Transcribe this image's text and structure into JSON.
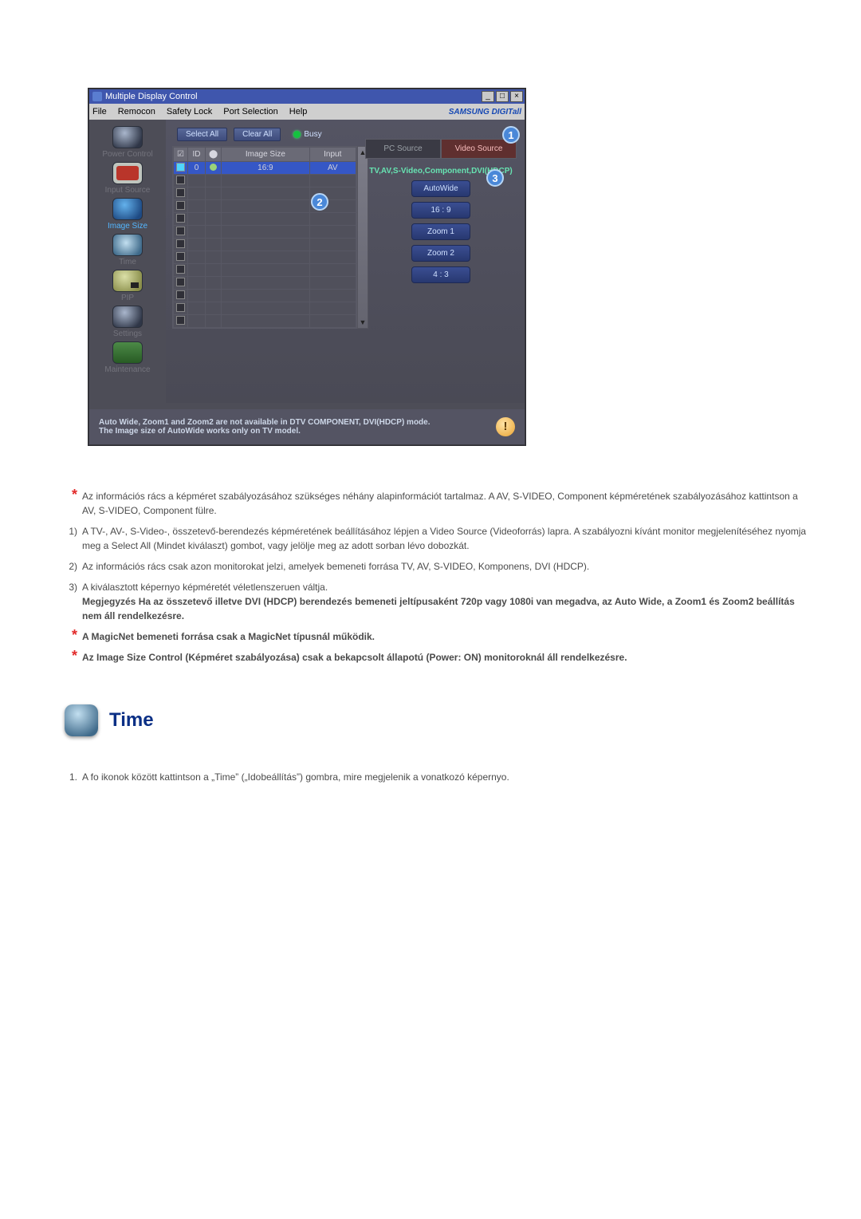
{
  "app": {
    "title": "Multiple Display Control",
    "menus": [
      "File",
      "Remocon",
      "Safety Lock",
      "Port Selection",
      "Help"
    ],
    "brand": "SAMSUNG DIGITall",
    "winbtns": {
      "min": "_",
      "max": "□",
      "close": "×"
    }
  },
  "sidebar": {
    "items": [
      {
        "label": "Power Control"
      },
      {
        "label": "Input Source"
      },
      {
        "label": "Image Size",
        "active": true
      },
      {
        "label": "Time"
      },
      {
        "label": "PIP"
      },
      {
        "label": "Settings"
      },
      {
        "label": "Maintenance"
      }
    ]
  },
  "toolbar": {
    "select_all": "Select All",
    "clear_all": "Clear All",
    "busy": "Busy"
  },
  "grid": {
    "headers": {
      "cb": "☑",
      "id": "ID",
      "lamp": "⬤",
      "size": "Image Size",
      "input": "Input"
    },
    "row0": {
      "id": "0",
      "size": "16:9",
      "input": "AV"
    }
  },
  "right": {
    "tab_pc": "PC Source",
    "tab_video": "Video Source",
    "subhead": "TV,AV,S-Video,Component,DVI(HDCP)",
    "opts": [
      "AutoWide",
      "16 : 9",
      "Zoom 1",
      "Zoom 2",
      "4 : 3"
    ]
  },
  "badges": {
    "b1": "1",
    "b2": "2",
    "b3": "3"
  },
  "footer": {
    "line1": "Auto Wide, Zoom1 and Zoom2 are not available in DTV COMPONENT, DVI(HDCP) mode.",
    "line2": "The Image size of AutoWide works only on TV model.",
    "warn": "!"
  },
  "paragraphs": {
    "p_star1": "Az információs rács a képméret szabályozásához szükséges néhány alapinformációt tartalmaz. A AV, S-VIDEO, Component képméretének szabályozásához kattintson a AV, S-VIDEO, Component fülre.",
    "p1": "A TV-, AV-, S-Video-, összetevő-berendezés képméretének beállításához lépjen a Video Source (Videoforrás) lapra. A szabályozni kívánt monitor megjelenítéséhez nyomja meg a Select All (Mindet kiválaszt) gombot, vagy jelölje meg az adott sorban lévo dobozkát.",
    "p2": "Az információs rács csak azon monitorokat jelzi, amelyek bemeneti forrása TV, AV, S-VIDEO, Komponens, DVI (HDCP).",
    "p3a": "A kiválasztott képernyo képméretét véletlenszeruen váltja.",
    "p3b": "Megjegyzés Ha az összetevő illetve DVI (HDCP) berendezés bemeneti jeltípusaként 720p vagy 1080i van megadva, az Auto Wide, a Zoom1 és Zoom2 beállítás nem áll rendelkezésre.",
    "p_star2": "A MagicNet bemeneti forrása csak a MagicNet típusnál működik.",
    "p_star3": "Az Image Size Control (Képméret szabályozása) csak a bekapcsolt állapotú (Power: ON) monitoroknál áll rendelkezésre."
  },
  "time_section": {
    "heading": "Time",
    "item1": "A fo ikonok között kattintson a „Time” („Idobeállítás”) gombra, mire megjelenik a vonatkozó képernyo."
  }
}
